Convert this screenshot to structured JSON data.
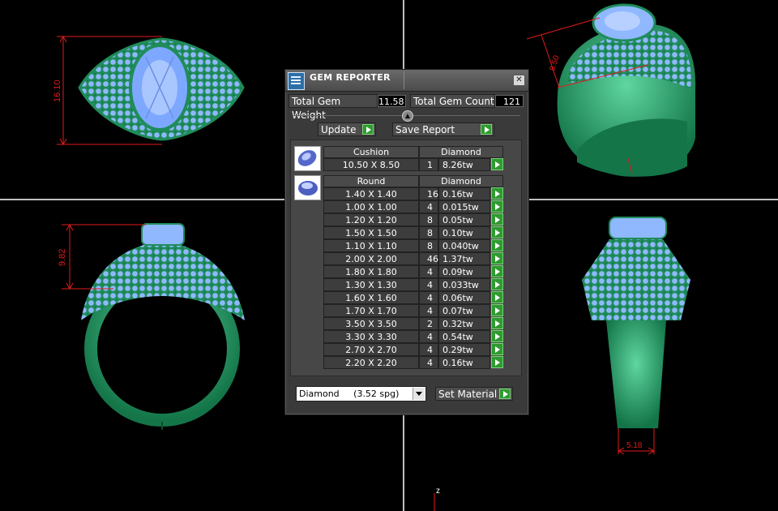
{
  "viewport": {
    "background": "#000000",
    "axis_color": "#ffffff",
    "metal_color": "#1f8c5a",
    "gem_color": "#8fb8ff",
    "dimension_color": "#e11b1b",
    "dimensions": {
      "top_view_height": "16.10",
      "front_view_height": "9.82",
      "side_view_width": "5.18",
      "perspective_label": "8.50",
      "z_axis_label": "z"
    }
  },
  "dialog": {
    "title": "GEM REPORTER",
    "close_icon": "close-icon",
    "total_weight_label": "Total Gem Weight",
    "total_weight_value": "11.58",
    "total_count_label": "Total Gem Count",
    "total_count_value": "121",
    "update_label": "Update",
    "save_label": "Save Report",
    "groups": [
      {
        "shape": "Cushion",
        "material": "Diamond",
        "icon": "cushion-gem-icon",
        "rows": [
          {
            "size": "10.50 X 8.50",
            "count": "1",
            "weight": "8.26tw"
          }
        ]
      },
      {
        "shape": "Round",
        "material": "Diamond",
        "icon": "round-gem-icon",
        "rows": [
          {
            "size": "1.40 X 1.40",
            "count": "16",
            "weight": "0.16tw"
          },
          {
            "size": "1.00 X 1.00",
            "count": "4",
            "weight": "0.015tw"
          },
          {
            "size": "1.20 X 1.20",
            "count": "8",
            "weight": "0.05tw"
          },
          {
            "size": "1.50 X 1.50",
            "count": "8",
            "weight": "0.10tw"
          },
          {
            "size": "1.10 X 1.10",
            "count": "8",
            "weight": "0.040tw"
          },
          {
            "size": "2.00 X 2.00",
            "count": "46",
            "weight": "1.37tw"
          },
          {
            "size": "1.80 X 1.80",
            "count": "4",
            "weight": "0.09tw"
          },
          {
            "size": "1.30 X 1.30",
            "count": "4",
            "weight": "0.033tw"
          },
          {
            "size": "1.60 X 1.60",
            "count": "4",
            "weight": "0.06tw"
          },
          {
            "size": "1.70 X 1.70",
            "count": "4",
            "weight": "0.07tw"
          },
          {
            "size": "3.50 X 3.50",
            "count": "2",
            "weight": "0.32tw"
          },
          {
            "size": "3.30 X 3.30",
            "count": "4",
            "weight": "0.54tw"
          },
          {
            "size": "2.70 X 2.70",
            "count": "4",
            "weight": "0.29tw"
          },
          {
            "size": "2.20 X 2.20",
            "count": "4",
            "weight": "0.16tw"
          }
        ]
      }
    ],
    "material_select_value": "Diamond     (3.52 spg)",
    "set_material_label": "Set Material"
  }
}
